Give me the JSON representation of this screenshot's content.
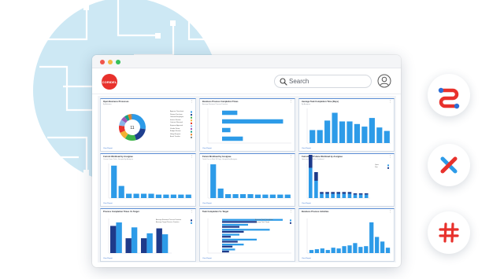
{
  "app": {
    "logo_text": "CORIDEL",
    "search": {
      "placeholder": "Search"
    }
  },
  "colors": {
    "accent_blue": "#2d9be8",
    "dark_blue": "#1e3a8a",
    "brand_red": "#e8312c",
    "bg_circle": "#cde8f4"
  },
  "cards": [
    {
      "title": "Open Business Processes",
      "subtitle": "By Activities",
      "report_link": "View Report",
      "donut_total": "11",
      "legend": [
        "Approve Timesheet",
        "Review Purchase",
        "Onboard Employee",
        "Invoice Review",
        "Contract Renewal",
        "Expense Approval",
        "Vendor Setup",
        "Budget Review",
        "Hiring Request",
        "Asset Transfer"
      ],
      "chart_data": {
        "type": "pie",
        "values": [
          3,
          2,
          1.5,
          1,
          1,
          0.8,
          0.6,
          0.5,
          0.4,
          0.2
        ],
        "colors": [
          "#2d9be8",
          "#1f3f8f",
          "#3db54a",
          "#f2b133",
          "#e8312c",
          "#8ab4e8",
          "#9b59b6",
          "#16a085",
          "#e67e22",
          "#7f8c8d"
        ]
      }
    },
    {
      "title": "Business Process Completion Times",
      "subtitle": "Average Business Process Duration",
      "report_link": "View Report",
      "chart_data": {
        "type": "bar",
        "orientation": "horizontal",
        "categories": [
          "",
          "",
          "",
          ""
        ],
        "values": [
          22,
          88,
          12,
          30
        ],
        "xlim": [
          0,
          100
        ]
      }
    },
    {
      "title": "Average Task Completion Time (Days)",
      "subtitle": "By Assignee",
      "report_link": "View Report",
      "chart_data": {
        "type": "bar",
        "values": [
          30,
          30,
          52,
          70,
          50,
          50,
          44,
          38,
          58,
          36,
          28
        ],
        "ylim": [
          0,
          80
        ]
      }
    },
    {
      "title": "Current Workload by Assignee",
      "subtitle": "Current Open Tasks, Grouped by Assignee",
      "report_link": "View Report",
      "chart_data": {
        "type": "bar",
        "values": [
          75,
          28,
          10,
          10,
          10,
          10,
          8,
          8,
          8,
          8,
          8
        ],
        "ylim": [
          0,
          80
        ]
      }
    },
    {
      "title": "Future Workload by Assignee",
      "subtitle": "Tasks Due in Next 30 Days, Grouped by Assignee",
      "report_link": "View Report",
      "chart_data": {
        "type": "bar",
        "values": [
          78,
          22,
          9,
          9,
          9,
          9,
          8,
          8,
          8,
          8,
          8
        ],
        "ylim": [
          0,
          80
        ]
      }
    },
    {
      "title": "Current and Future Workload by Assignee",
      "subtitle": "Open and Due Tasks Combined",
      "report_link": "View Report",
      "legend": [
        "Open",
        "Due"
      ],
      "chart_data": {
        "type": "bar",
        "series": [
          {
            "values": [
              70,
              40,
              10,
              10,
              10,
              10,
              10,
              10,
              8,
              8,
              8
            ]
          },
          {
            "values": [
              30,
              20,
              4,
              4,
              4,
              4,
              4,
              4,
              3,
              3,
              3
            ]
          }
        ],
        "ylim": [
          0,
          80
        ]
      }
    },
    {
      "title": "Process Completion Times Vs Target",
      "subtitle": "",
      "report_link": "View Report",
      "legend": [
        "Average Business Process Duration",
        "Average Target Process Duration"
      ],
      "chart_data": {
        "type": "bar",
        "series": [
          {
            "values": [
              55,
              30,
              30,
              50
            ]
          },
          {
            "values": [
              62,
              52,
              40,
              38
            ]
          }
        ],
        "ylim": [
          0,
          70
        ]
      }
    },
    {
      "title": "Task Completion Vs Target",
      "subtitle": "",
      "report_link": "View Report",
      "legend": [
        "Average Task Completion",
        "Average Task Target"
      ],
      "chart_data": {
        "type": "bar",
        "orientation": "horizontal",
        "series": [
          {
            "values": [
              70,
              30,
              55,
              20,
              40,
              25,
              15
            ]
          },
          {
            "values": [
              40,
              20,
              25,
              10,
              18,
              12,
              8
            ]
          }
        ],
        "xlim": [
          0,
          80
        ]
      }
    },
    {
      "title": "Business Process Activities",
      "subtitle": "",
      "report_link": "View Report",
      "chart_data": {
        "type": "bar",
        "values": [
          8,
          10,
          12,
          8,
          14,
          12,
          18,
          20,
          26,
          16,
          18,
          80,
          42,
          30,
          14
        ],
        "ylim": [
          0,
          90
        ]
      }
    }
  ],
  "side_apps": [
    {
      "icon": "red-blue-integration-icon"
    },
    {
      "icon": "red-blue-cross-icon"
    },
    {
      "icon": "red-hashtag-icon"
    }
  ]
}
